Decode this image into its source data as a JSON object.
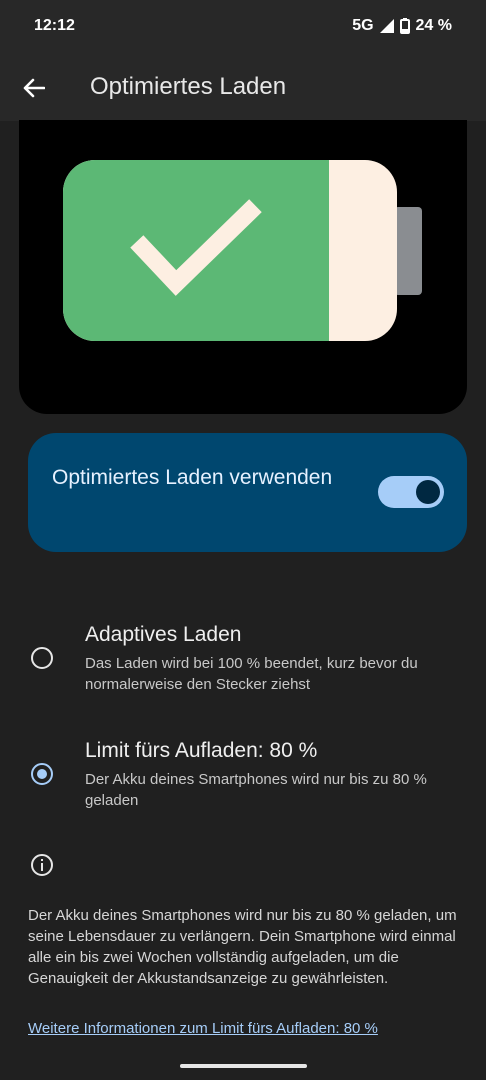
{
  "status_bar": {
    "time": "12:12",
    "network": "5G",
    "battery": "24 %"
  },
  "app_bar": {
    "title": "Optimiertes Laden",
    "back_icon": "arrow-back-icon"
  },
  "illustration": {
    "battery_body_color": "#fdefe2",
    "battery_fill_color": "#5cb875",
    "battery_cap_color": "#8a8d91",
    "check_color": "#fdefe2",
    "icons": [
      "battery-icon",
      "checkmark-icon"
    ]
  },
  "toggle": {
    "label": "Optimiertes Laden verwenden",
    "enabled": true
  },
  "options": [
    {
      "title": "Adaptives Laden",
      "summary": "Das Laden wird bei 100 % beendet, kurz bevor du normalerweise den Stecker ziehst",
      "selected": false
    },
    {
      "title": "Limit fürs Aufladen: 80 %",
      "summary": "Der Akku deines Smartphones wird nur bis zu 80 % geladen",
      "selected": true
    }
  ],
  "footer": {
    "info_icon": "info-icon",
    "text": "Der Akku deines Smartphones wird nur bis zu 80 % geladen, um seine Lebensdauer zu verlängern. Dein Smartphone wird einmal alle ein bis zwei Wochen vollständig aufgeladen, um die Genauigkeit der Akkustandsanzeige zu gewährleisten.",
    "link": "Weitere Informationen zum Limit fürs Aufladen: 80 %"
  },
  "colors": {
    "background": "#202020",
    "card": "#00476f",
    "accent": "#a6cdf8"
  }
}
